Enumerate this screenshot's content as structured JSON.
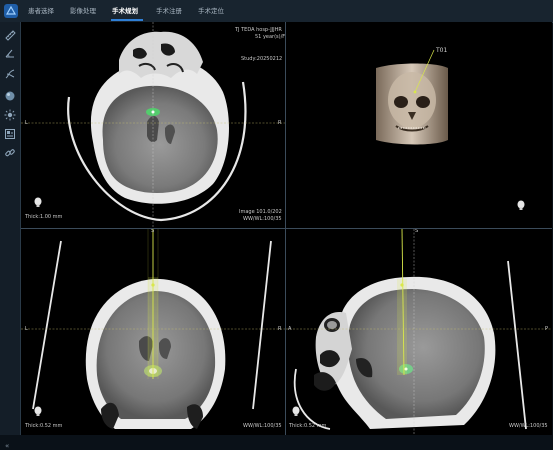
{
  "app": {
    "tabs": [
      {
        "label": "患者选择"
      },
      {
        "label": "影像处理"
      },
      {
        "label": "手术规划"
      },
      {
        "label": "手术注册"
      },
      {
        "label": "手术定位"
      }
    ],
    "active_tab_index": 2
  },
  "sidebar": {
    "icons": [
      "ruler-icon",
      "angle-icon",
      "fiber-icon",
      "sphere-icon",
      "light-icon",
      "settings-icon",
      "link-icon"
    ],
    "collapse_label": "«"
  },
  "views": {
    "axial": {
      "hospital": "TJ TEDA hosp-JJJHR",
      "age_sex": "51 year(s)/F",
      "study": "Study:20250212",
      "thick": "Thick:1.00 mm",
      "image": "Image 101.0/202",
      "wwwl": "WW/WL:100/35",
      "left": "L",
      "right": "R"
    },
    "render3d": {
      "target_label": "T01"
    },
    "coronal": {
      "thick": "Thick:0.52 mm",
      "wwwl": "WW/WL:100/35",
      "left": "L",
      "right": "R",
      "top": "S"
    },
    "sagittal": {
      "thick": "Thick:0.52 mm",
      "wwwl": "WW/WL:100/35",
      "left": "A",
      "right": "P",
      "top": "S"
    }
  },
  "colors": {
    "accent": "#2f7fd6",
    "trajectory": "#d9e84a",
    "target": "#5ef07a",
    "crosshair_h": "#c8c070",
    "crosshair_v": "#d0d0d0"
  }
}
